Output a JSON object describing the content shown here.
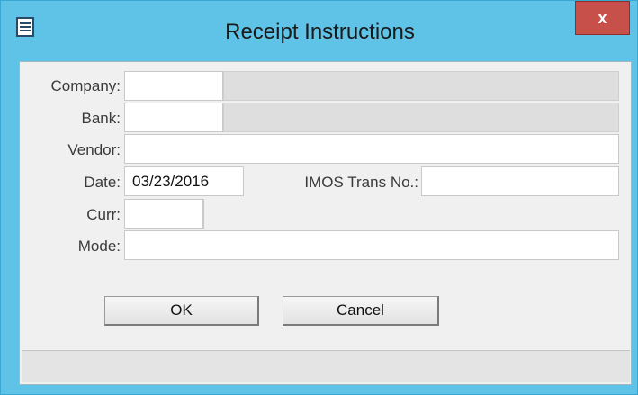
{
  "window": {
    "title": "Receipt Instructions",
    "close_label": "x"
  },
  "form": {
    "company_label": "Company:",
    "bank_label": "Bank:",
    "vendor_label": "Vendor:",
    "date_label": "Date:",
    "date_value": "03/23/2016",
    "imos_label": "IMOS Trans No.:",
    "curr_label": "Curr:",
    "mode_label": "Mode:"
  },
  "buttons": {
    "ok_label": "OK",
    "cancel_label": "Cancel"
  },
  "colors": {
    "titlebar": "#5fc3e8",
    "close": "#c8504a",
    "client": "#f0f0f0"
  }
}
